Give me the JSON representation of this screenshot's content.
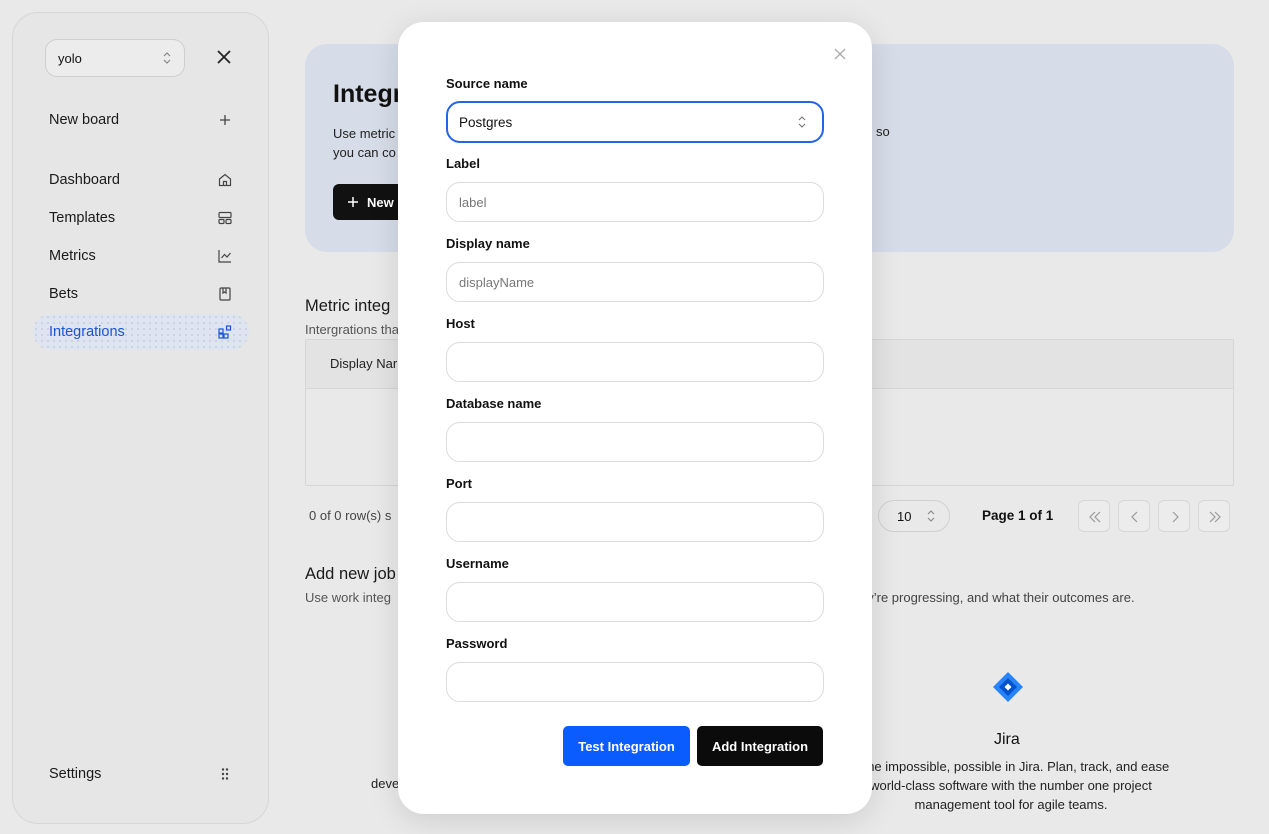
{
  "sidebar": {
    "workspace": "yolo",
    "new_board": "New board",
    "items": [
      {
        "label": "Dashboard",
        "icon": "home-icon"
      },
      {
        "label": "Templates",
        "icon": "templates-icon"
      },
      {
        "label": "Metrics",
        "icon": "chart-icon"
      },
      {
        "label": "Bets",
        "icon": "bookmark-icon"
      },
      {
        "label": "Integrations",
        "icon": "integrations-icon",
        "active": true
      }
    ],
    "settings": "Settings"
  },
  "main": {
    "hero": {
      "title": "Integr",
      "desc_line1": "Use metric",
      "desc_line2": "you can co",
      "desc_tail": "so",
      "button_label": "New"
    },
    "metric_section": {
      "title": "Metric integ",
      "subtitle": "Intergrations tha"
    },
    "table": {
      "header": "Display Nar"
    },
    "pagination": {
      "rows_count": "0 of 0 row(s) s",
      "page_size": "10",
      "page_label": "Page 1 of 1"
    },
    "jobs_section": {
      "title": "Add new job",
      "subtitle": "Use work integ",
      "subtitle_tail": "ey’re progressing, and what their outcomes are."
    },
    "jira": {
      "title": "Jira",
      "desc": "e the impossible, possible in Jira. Plan, track, and ease world-class software with the number one project management tool for agile teams."
    },
    "left_card_fragment": "deve"
  },
  "modal": {
    "source_name_label": "Source name",
    "source_name_value": "Postgres",
    "label_label": "Label",
    "label_placeholder": "label",
    "display_name_label": "Display name",
    "display_name_placeholder": "displayName",
    "host_label": "Host",
    "database_name_label": "Database name",
    "port_label": "Port",
    "username_label": "Username",
    "password_label": "Password",
    "test_button": "Test Integration",
    "add_button": "Add Integration"
  },
  "colors": {
    "accent_blue": "#0a5cff",
    "focus_ring": "#2563eb",
    "active_nav_text": "#1a55d8",
    "dark_button": "#0b0b0b",
    "jira_blue": "#2684ff"
  }
}
